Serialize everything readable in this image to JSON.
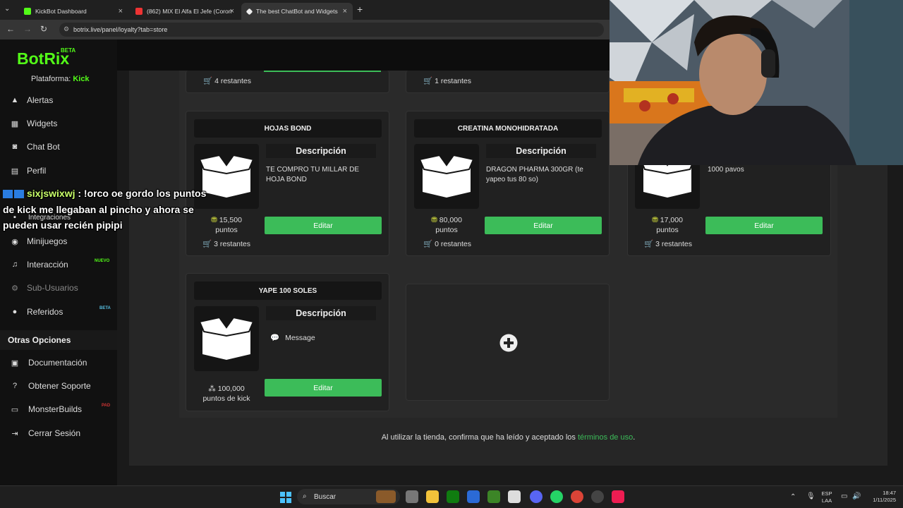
{
  "browser": {
    "tabs": [
      {
        "title": "KickBot Dashboard",
        "active": false
      },
      {
        "title": "(862) MIX El Alfa El Jefe (Coron",
        "active": false
      },
      {
        "title": "The best ChatBot and Widgets",
        "active": true
      }
    ],
    "url": "botrix.live/panel/loyalty?tab=store"
  },
  "sidebar": {
    "logo": "BotRix",
    "logo_badge": "BETA",
    "platform_label": "Plataforma:",
    "platform_value": "Kick",
    "items": [
      {
        "label": "Alertas",
        "icon": "warning-icon"
      },
      {
        "label": "Widgets",
        "icon": "grid-icon"
      },
      {
        "label": "Chat Bot",
        "icon": "robot-icon"
      },
      {
        "label": "Perfil",
        "icon": "id-card-icon"
      },
      {
        "label": "Integraciones",
        "icon": "plug-icon"
      },
      {
        "label": "Minijuegos",
        "icon": "gamepad-icon"
      },
      {
        "label": "Interacción",
        "icon": "music-icon",
        "badge": "NUEVO"
      },
      {
        "label": "Sub-Usuarios",
        "icon": "users-cog-icon",
        "disabled": true
      },
      {
        "label": "Referidos",
        "icon": "users-icon",
        "badge": "BETA"
      }
    ],
    "other_heading": "Otras Opciones",
    "other_items": [
      {
        "label": "Documentación",
        "icon": "book-icon"
      },
      {
        "label": "Obtener Soporte",
        "icon": "question-icon"
      },
      {
        "label": "MonsterBuilds",
        "icon": "monitor-icon",
        "badge": "PAD"
      },
      {
        "label": "Cerrar Sesión",
        "icon": "logout-icon"
      }
    ]
  },
  "store": {
    "partial_cards": [
      {
        "stock": "4 restantes"
      },
      {
        "stock": "1 restantes"
      }
    ],
    "cards": [
      {
        "title": "HOJAS BOND",
        "desc_heading": "Descripción",
        "desc": "TE COMPRO TU MILLAR DE HOJA BOND",
        "points": "15,500",
        "points_unit": "puntos",
        "stock": "3 restantes",
        "button": "Editar"
      },
      {
        "title": "CREATINA MONOHIDRATADA",
        "desc_heading": "Descripción",
        "desc": "DRAGON PHARMA 300GR (te yapeo tus 80 so)",
        "points": "80,000",
        "points_unit": "puntos",
        "stock": "0 restantes",
        "button": "Editar"
      },
      {
        "title": "",
        "desc_heading": "",
        "desc": "1000 pavos",
        "points": "17,000",
        "points_unit": "puntos",
        "stock": "3 restantes",
        "button": "Editar"
      },
      {
        "title": "YAPE 100 SOLES",
        "desc_heading": "Descripción",
        "desc": "Message",
        "points": "100,000",
        "points_unit": "puntos de kick",
        "stock": "",
        "button": "Editar"
      }
    ],
    "add_icon": "plus-circle-icon",
    "footer_prefix": "Al utilizar la tienda, confirma que ha leído y aceptado los",
    "footer_link": "términos de uso",
    "footer_suffix": "."
  },
  "chat_overlay": {
    "username": "sixjswixwj",
    "message": ": !orco oe gordo los puntos de kick me llegaban al pincho y ahora se pueden usar recién pipipi",
    "line1": ": !orco oe gordo los puntos",
    "line2": "de kick me llegaban al pincho y ahora se",
    "line3": "pueden usar recién pipipi"
  },
  "taskbar": {
    "search_placeholder": "Buscar",
    "lang_top": "ESP",
    "lang_bottom": "LAA",
    "time": "18:47",
    "date": "1/11/2025"
  },
  "colors": {
    "accent": "#3cbc59",
    "logo": "#53fc18"
  }
}
